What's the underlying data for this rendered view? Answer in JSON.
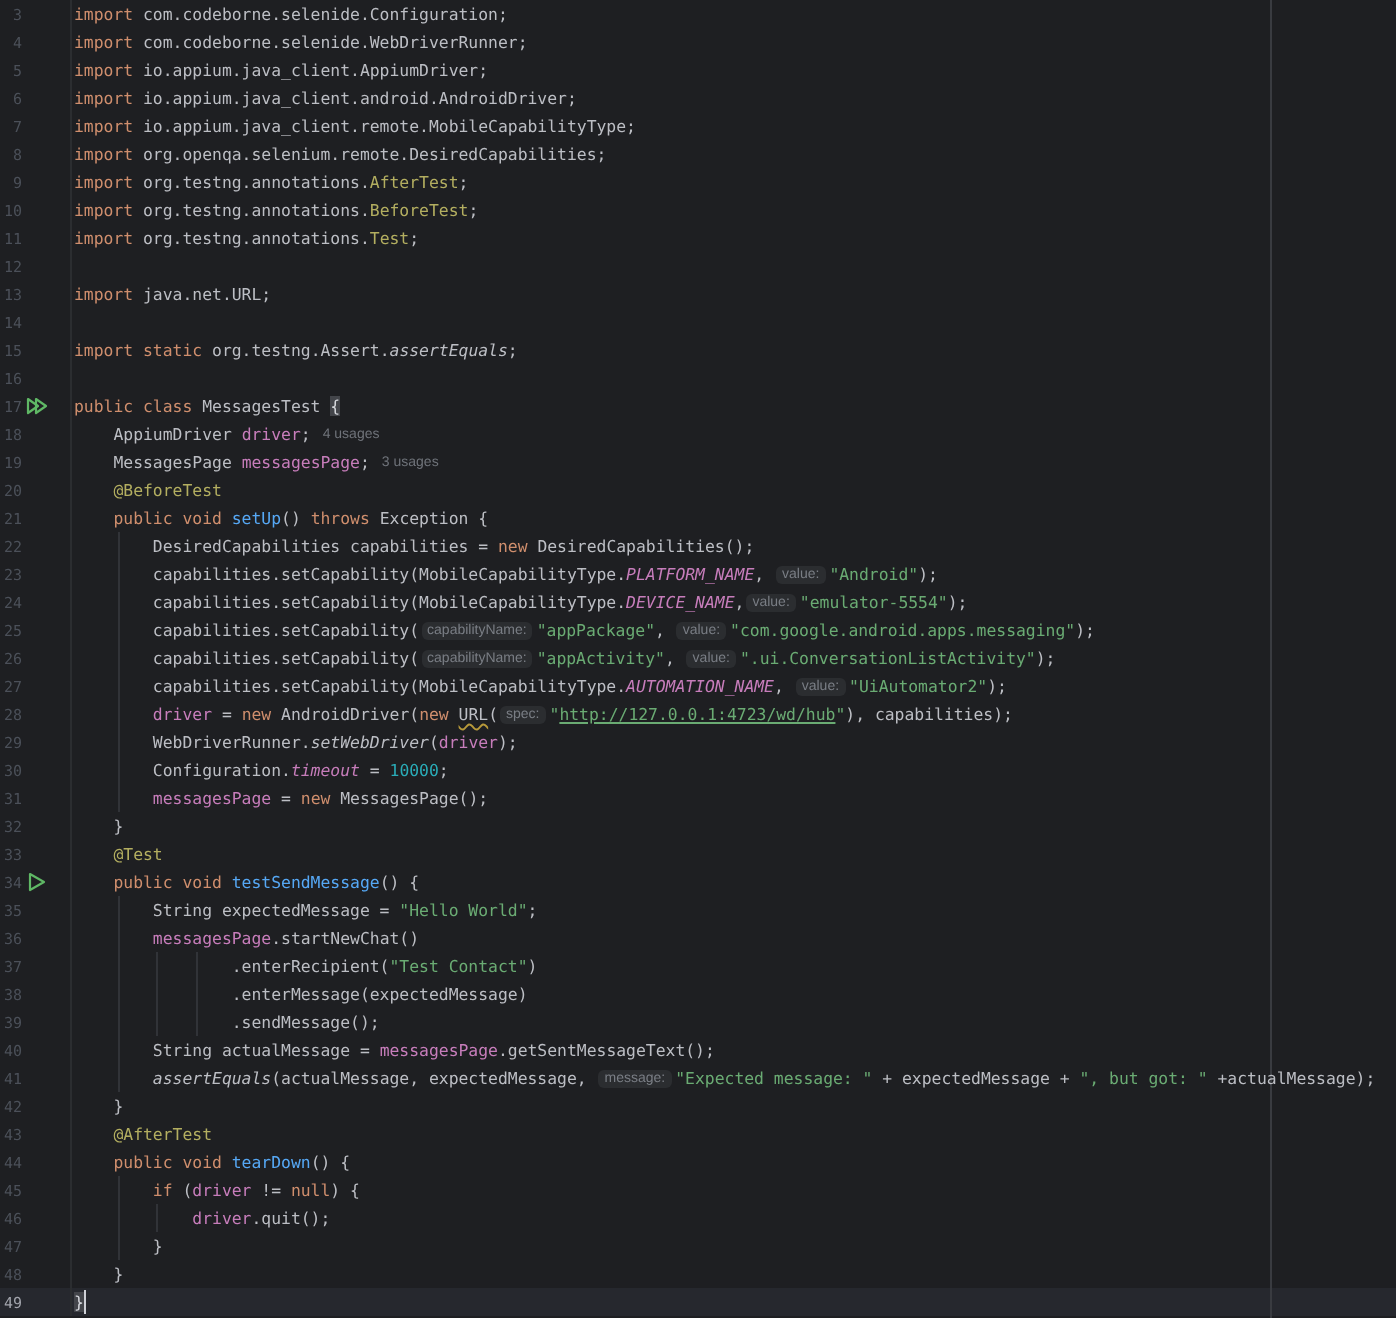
{
  "editor": {
    "lines": [
      {
        "number": "3",
        "tokens": [
          {
            "kind": "kw",
            "text": "import"
          },
          {
            "kind": "plain",
            "text": " com.codeborne.selenide.Configuration;"
          }
        ]
      },
      {
        "number": "4",
        "tokens": [
          {
            "kind": "kw",
            "text": "import"
          },
          {
            "kind": "plain",
            "text": " com.codeborne.selenide.WebDriverRunner;"
          }
        ]
      },
      {
        "number": "5",
        "tokens": [
          {
            "kind": "kw",
            "text": "import"
          },
          {
            "kind": "plain",
            "text": " io.appium.java_client.AppiumDriver;"
          }
        ]
      },
      {
        "number": "6",
        "tokens": [
          {
            "kind": "kw",
            "text": "import"
          },
          {
            "kind": "plain",
            "text": " io.appium.java_client.android.AndroidDriver;"
          }
        ]
      },
      {
        "number": "7",
        "tokens": [
          {
            "kind": "kw",
            "text": "import"
          },
          {
            "kind": "plain",
            "text": " io.appium.java_client.remote.MobileCapabilityType;"
          }
        ]
      },
      {
        "number": "8",
        "tokens": [
          {
            "kind": "kw",
            "text": "import"
          },
          {
            "kind": "plain",
            "text": " org.openqa.selenium.remote.DesiredCapabilities;"
          }
        ]
      },
      {
        "number": "9",
        "tokens": [
          {
            "kind": "kw",
            "text": "import"
          },
          {
            "kind": "plain",
            "text": " org.testng.annotations."
          },
          {
            "kind": "ann",
            "text": "AfterTest"
          },
          {
            "kind": "plain",
            "text": ";"
          }
        ]
      },
      {
        "number": "10",
        "tokens": [
          {
            "kind": "kw",
            "text": "import"
          },
          {
            "kind": "plain",
            "text": " org.testng.annotations."
          },
          {
            "kind": "ann",
            "text": "BeforeTest"
          },
          {
            "kind": "plain",
            "text": ";"
          }
        ]
      },
      {
        "number": "11",
        "tokens": [
          {
            "kind": "kw",
            "text": "import"
          },
          {
            "kind": "plain",
            "text": " org.testng.annotations."
          },
          {
            "kind": "ann",
            "text": "Test"
          },
          {
            "kind": "plain",
            "text": ";"
          }
        ]
      },
      {
        "number": "12"
      },
      {
        "number": "13",
        "tokens": [
          {
            "kind": "kw",
            "text": "import"
          },
          {
            "kind": "plain",
            "text": " java.net.URL;"
          }
        ]
      },
      {
        "number": "14"
      },
      {
        "number": "15",
        "tokens": [
          {
            "kind": "kw",
            "text": "import static"
          },
          {
            "kind": "plain",
            "text": " org.testng.Assert."
          },
          {
            "kind": "smethod",
            "text": "assertEquals"
          },
          {
            "kind": "plain",
            "text": ";"
          }
        ]
      },
      {
        "number": "16"
      },
      {
        "number": "17",
        "gutter_marker": {
          "kind": "double"
        },
        "tokens": [
          {
            "kind": "kw",
            "text": "public class"
          },
          {
            "kind": "plain",
            "text": " MessagesTest "
          },
          {
            "kind": "brace",
            "text": "{"
          }
        ]
      },
      {
        "number": "18",
        "tokens": [
          {
            "kind": "plain",
            "text": "    AppiumDriver "
          },
          {
            "kind": "field",
            "text": "driver"
          },
          {
            "kind": "plain",
            "text": ";"
          },
          {
            "kind": "usage",
            "text": "4 usages"
          }
        ]
      },
      {
        "number": "19",
        "tokens": [
          {
            "kind": "plain",
            "text": "    MessagesPage "
          },
          {
            "kind": "field",
            "text": "messagesPage"
          },
          {
            "kind": "plain",
            "text": ";"
          },
          {
            "kind": "usage",
            "text": "3 usages"
          }
        ]
      },
      {
        "number": "20",
        "tokens": [
          {
            "kind": "ann",
            "text": "    @BeforeTest"
          }
        ]
      },
      {
        "number": "21",
        "tokens": [
          {
            "kind": "kw",
            "text": "    public void "
          },
          {
            "kind": "decl",
            "text": "setUp"
          },
          {
            "kind": "plain",
            "text": "() "
          },
          {
            "kind": "kw",
            "text": "throws"
          },
          {
            "kind": "plain",
            "text": " Exception {"
          }
        ]
      },
      {
        "number": "22",
        "tokens": [
          {
            "kind": "plain",
            "text": "        DesiredCapabilities capabilities = "
          },
          {
            "kind": "kw",
            "text": "new"
          },
          {
            "kind": "plain",
            "text": " DesiredCapabilities();"
          }
        ]
      },
      {
        "number": "23",
        "tokens": [
          {
            "kind": "plain",
            "text": "        capabilities.setCapability(MobileCapabilityType."
          },
          {
            "kind": "sfield",
            "text": "PLATFORM_NAME"
          },
          {
            "kind": "plain",
            "text": ", "
          },
          {
            "kind": "hint",
            "text": "value:"
          },
          {
            "kind": "str",
            "text": "\"Android\""
          },
          {
            "kind": "plain",
            "text": ");"
          }
        ]
      },
      {
        "number": "24",
        "tokens": [
          {
            "kind": "plain",
            "text": "        capabilities.setCapability(MobileCapabilityType."
          },
          {
            "kind": "sfield",
            "text": "DEVICE_NAME"
          },
          {
            "kind": "plain",
            "text": ","
          },
          {
            "kind": "hint",
            "text": "value:"
          },
          {
            "kind": "str",
            "text": "\"emulator-5554\""
          },
          {
            "kind": "plain",
            "text": ");"
          }
        ]
      },
      {
        "number": "25",
        "tokens": [
          {
            "kind": "plain",
            "text": "        capabilities.setCapability("
          },
          {
            "kind": "hint",
            "text": "capabilityName:"
          },
          {
            "kind": "str",
            "text": "\"appPackage\""
          },
          {
            "kind": "plain",
            "text": ", "
          },
          {
            "kind": "hint",
            "text": "value:"
          },
          {
            "kind": "str",
            "text": "\"com.google.android.apps.messaging\""
          },
          {
            "kind": "plain",
            "text": ");"
          }
        ]
      },
      {
        "number": "26",
        "tokens": [
          {
            "kind": "plain",
            "text": "        capabilities.setCapability("
          },
          {
            "kind": "hint",
            "text": "capabilityName:"
          },
          {
            "kind": "str",
            "text": "\"appActivity\""
          },
          {
            "kind": "plain",
            "text": ", "
          },
          {
            "kind": "hint",
            "text": "value:"
          },
          {
            "kind": "str",
            "text": "\".ui.ConversationListActivity\""
          },
          {
            "kind": "plain",
            "text": ");"
          }
        ]
      },
      {
        "number": "27",
        "tokens": [
          {
            "kind": "plain",
            "text": "        capabilities.setCapability(MobileCapabilityType."
          },
          {
            "kind": "sfield",
            "text": "AUTOMATION_NAME"
          },
          {
            "kind": "plain",
            "text": ", "
          },
          {
            "kind": "hint",
            "text": "value:"
          },
          {
            "kind": "str",
            "text": "\"UiAutomator2\""
          },
          {
            "kind": "plain",
            "text": ");"
          }
        ]
      },
      {
        "number": "28",
        "tokens": [
          {
            "kind": "field",
            "text": "        driver"
          },
          {
            "kind": "plain",
            "text": " = "
          },
          {
            "kind": "kw",
            "text": "new"
          },
          {
            "kind": "plain",
            "text": " AndroidDriver("
          },
          {
            "kind": "kw",
            "text": "new "
          },
          {
            "kind": "warn",
            "text": "URL"
          },
          {
            "kind": "plain",
            "text": "("
          },
          {
            "kind": "hint",
            "text": "spec:"
          },
          {
            "kind": "str",
            "text": "\""
          },
          {
            "kind": "url",
            "text": "http://127.0.0.1:4723/wd/hub"
          },
          {
            "kind": "str",
            "text": "\""
          },
          {
            "kind": "plain",
            "text": "), capabilities);"
          }
        ]
      },
      {
        "number": "29",
        "tokens": [
          {
            "kind": "plain",
            "text": "        WebDriverRunner."
          },
          {
            "kind": "smethod",
            "text": "setWebDriver"
          },
          {
            "kind": "plain",
            "text": "("
          },
          {
            "kind": "field",
            "text": "driver"
          },
          {
            "kind": "plain",
            "text": ");"
          }
        ]
      },
      {
        "number": "30",
        "tokens": [
          {
            "kind": "plain",
            "text": "        Configuration."
          },
          {
            "kind": "sfield",
            "text": "timeout"
          },
          {
            "kind": "plain",
            "text": " = "
          },
          {
            "kind": "num",
            "text": "10000"
          },
          {
            "kind": "plain",
            "text": ";"
          }
        ]
      },
      {
        "number": "31",
        "tokens": [
          {
            "kind": "field",
            "text": "        messagesPage"
          },
          {
            "kind": "plain",
            "text": " = "
          },
          {
            "kind": "kw",
            "text": "new"
          },
          {
            "kind": "plain",
            "text": " MessagesPage();"
          }
        ]
      },
      {
        "number": "32",
        "tokens": [
          {
            "kind": "plain",
            "text": "    }"
          }
        ]
      },
      {
        "number": "33",
        "tokens": [
          {
            "kind": "ann",
            "text": "    @Test"
          }
        ]
      },
      {
        "number": "34",
        "gutter_marker": {
          "kind": "single"
        },
        "tokens": [
          {
            "kind": "kw",
            "text": "    public void "
          },
          {
            "kind": "decl",
            "text": "testSendMessage"
          },
          {
            "kind": "plain",
            "text": "() {"
          }
        ]
      },
      {
        "number": "35",
        "tokens": [
          {
            "kind": "plain",
            "text": "        String expectedMessage = "
          },
          {
            "kind": "str",
            "text": "\"Hello World\""
          },
          {
            "kind": "plain",
            "text": ";"
          }
        ]
      },
      {
        "number": "36",
        "tokens": [
          {
            "kind": "field",
            "text": "        messagesPage"
          },
          {
            "kind": "plain",
            "text": ".startNewChat()"
          }
        ]
      },
      {
        "number": "37",
        "tokens": [
          {
            "kind": "plain",
            "text": "                .enterRecipient("
          },
          {
            "kind": "str",
            "text": "\"Test Contact\""
          },
          {
            "kind": "plain",
            "text": ")"
          }
        ]
      },
      {
        "number": "38",
        "tokens": [
          {
            "kind": "plain",
            "text": "                .enterMessage(expectedMessage)"
          }
        ]
      },
      {
        "number": "39",
        "tokens": [
          {
            "kind": "plain",
            "text": "                .sendMessage();"
          }
        ]
      },
      {
        "number": "40",
        "tokens": [
          {
            "kind": "plain",
            "text": "        String actualMessage = "
          },
          {
            "kind": "field",
            "text": "messagesPage"
          },
          {
            "kind": "plain",
            "text": ".getSentMessageText();"
          }
        ]
      },
      {
        "number": "41",
        "tokens": [
          {
            "kind": "smethod",
            "text": "        assertEquals"
          },
          {
            "kind": "plain",
            "text": "(actualMessage, expectedMessage, "
          },
          {
            "kind": "hint",
            "text": "message:"
          },
          {
            "kind": "str",
            "text": "\"Expected message: \""
          },
          {
            "kind": "plain",
            "text": " + expectedMessage + "
          },
          {
            "kind": "str",
            "text": "\", but got: \""
          },
          {
            "kind": "plain",
            "text": " +actualMessage);"
          }
        ]
      },
      {
        "number": "42",
        "tokens": [
          {
            "kind": "plain",
            "text": "    }"
          }
        ]
      },
      {
        "number": "43",
        "tokens": [
          {
            "kind": "ann",
            "text": "    @AfterTest"
          }
        ]
      },
      {
        "number": "44",
        "tokens": [
          {
            "kind": "kw",
            "text": "    public void "
          },
          {
            "kind": "decl",
            "text": "tearDown"
          },
          {
            "kind": "plain",
            "text": "() {"
          }
        ]
      },
      {
        "number": "45",
        "tokens": [
          {
            "kind": "kw",
            "text": "        if"
          },
          {
            "kind": "plain",
            "text": " ("
          },
          {
            "kind": "field",
            "text": "driver"
          },
          {
            "kind": "plain",
            "text": " != "
          },
          {
            "kind": "kw",
            "text": "null"
          },
          {
            "kind": "plain",
            "text": ") {"
          }
        ]
      },
      {
        "number": "46",
        "tokens": [
          {
            "kind": "field",
            "text": "            driver"
          },
          {
            "kind": "plain",
            "text": ".quit();"
          }
        ]
      },
      {
        "number": "47",
        "tokens": [
          {
            "kind": "plain",
            "text": "        }"
          }
        ]
      },
      {
        "number": "48",
        "tokens": [
          {
            "kind": "plain",
            "text": "    }"
          }
        ]
      },
      {
        "number": "49",
        "current": true,
        "tokens": [
          {
            "kind": "brace",
            "text": "}"
          }
        ]
      }
    ]
  }
}
